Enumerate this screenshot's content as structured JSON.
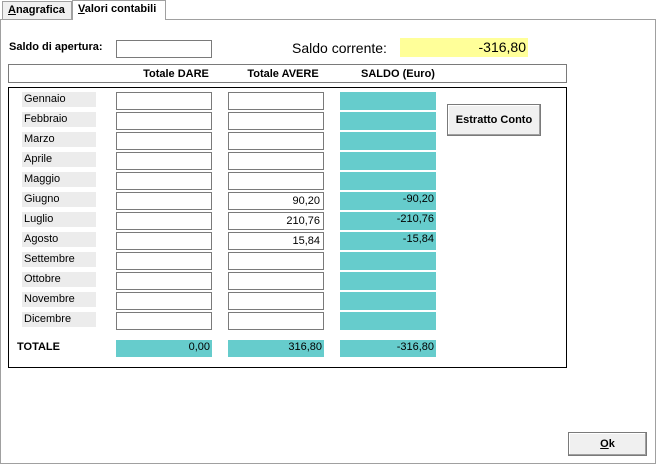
{
  "tabs": [
    {
      "label_pre": "",
      "label_ul": "A",
      "label_post": "nagrafica"
    },
    {
      "label_pre": "",
      "label_ul": "V",
      "label_post": "alori contabili"
    }
  ],
  "saldo_apertura": {
    "label": "Saldo di apertura:",
    "value": ""
  },
  "saldo_corrente": {
    "label": "Saldo corrente:",
    "value": "-316,80"
  },
  "columns": {
    "dare": "Totale DARE",
    "avere": "Totale AVERE",
    "saldo": "SALDO (Euro)"
  },
  "months": [
    {
      "name": "Gennaio",
      "dare": "",
      "avere": "",
      "saldo": ""
    },
    {
      "name": "Febbraio",
      "dare": "",
      "avere": "",
      "saldo": ""
    },
    {
      "name": "Marzo",
      "dare": "",
      "avere": "",
      "saldo": ""
    },
    {
      "name": "Aprile",
      "dare": "",
      "avere": "",
      "saldo": ""
    },
    {
      "name": "Maggio",
      "dare": "",
      "avere": "",
      "saldo": ""
    },
    {
      "name": "Giugno",
      "dare": "",
      "avere": "90,20",
      "saldo": "-90,20"
    },
    {
      "name": "Luglio",
      "dare": "",
      "avere": "210,76",
      "saldo": "-210,76"
    },
    {
      "name": "Agosto",
      "dare": "",
      "avere": "15,84",
      "saldo": "-15,84"
    },
    {
      "name": "Settembre",
      "dare": "",
      "avere": "",
      "saldo": ""
    },
    {
      "name": "Ottobre",
      "dare": "",
      "avere": "",
      "saldo": ""
    },
    {
      "name": "Novembre",
      "dare": "",
      "avere": "",
      "saldo": ""
    },
    {
      "name": "Dicembre",
      "dare": "",
      "avere": "",
      "saldo": ""
    }
  ],
  "totale": {
    "label": "TOTALE",
    "dare": "0,00",
    "avere": "316,80",
    "saldo": "-316,80"
  },
  "buttons": {
    "estratto": "Estratto Conto",
    "ok_ul": "O",
    "ok_post": "k"
  },
  "colors": {
    "saldo_fill": "#66cccc",
    "saldo_corrente_fill": "#ffff99",
    "month_label_fill": "#ececec"
  }
}
